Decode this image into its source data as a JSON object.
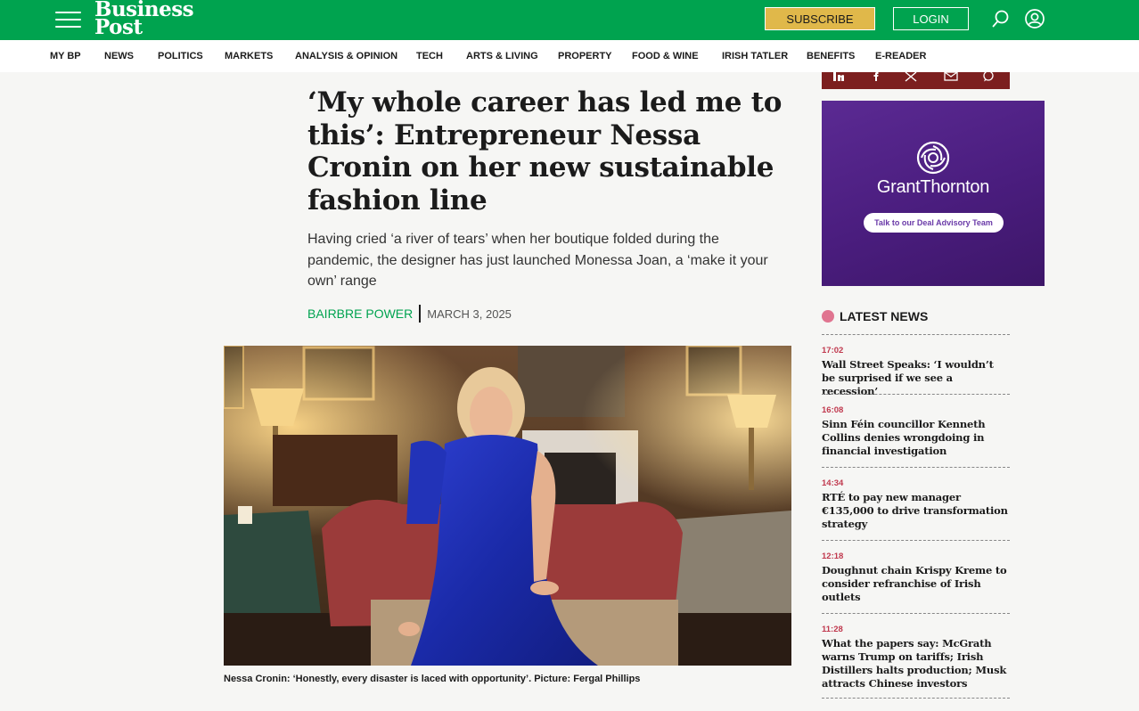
{
  "header": {
    "logo_line1": "Business",
    "logo_line2": "Post",
    "subscribe_label": "SUBSCRIBE",
    "login_label": "LOGIN",
    "brand_color": "#00a34f",
    "subscribe_color": "#e0b84a"
  },
  "nav": {
    "items": [
      "MY BP",
      "NEWS",
      "POLITICS",
      "MARKETS",
      "ANALYSIS & OPINION",
      "TECH",
      "ARTS & LIVING",
      "PROPERTY",
      "FOOD & WINE",
      "IRISH TATLER",
      "BENEFITS",
      "E-READER"
    ]
  },
  "article": {
    "headline": "‘My whole career has led me to this’: Entrepreneur Nessa Cronin on her new sustainable fashion line",
    "standfirst": "Having cried ‘a river of tears’ when her boutique folded during the pandemic, the designer has just launched Monessa Joan, a ‘make it your own’ range",
    "author": "BAIRBRE POWER",
    "date": "MARCH 3, 2025",
    "caption": "Nessa Cronin: ‘Honestly, every disaster is laced with opportunity’. Picture: Fergal Phillips"
  },
  "share": {
    "icons": [
      "linkedin-icon",
      "facebook-icon",
      "x-icon",
      "email-icon",
      "whatsapp-icon"
    ]
  },
  "ad": {
    "brand": "GrantThornton",
    "cta": "Talk to our Deal Advisory Team"
  },
  "latest": {
    "title": "LATEST NEWS",
    "items": [
      {
        "time": "17:02",
        "headline": "Wall Street Speaks: ‘I wouldn’t be surprised if we see a recession’"
      },
      {
        "time": "16:08",
        "headline": "Sinn Féin councillor Kenneth Collins denies wrongdoing in financial investigation"
      },
      {
        "time": "14:34",
        "headline": "RTÉ to pay new manager €135,000 to drive transformation strategy"
      },
      {
        "time": "12:18",
        "headline": "Doughnut chain Krispy Kreme to consider refranchise of Irish outlets"
      },
      {
        "time": "11:28",
        "headline": "What the papers say: McGrath warns Trump on tariffs; Irish Distillers halts production; Musk attracts Chinese investors"
      }
    ]
  }
}
